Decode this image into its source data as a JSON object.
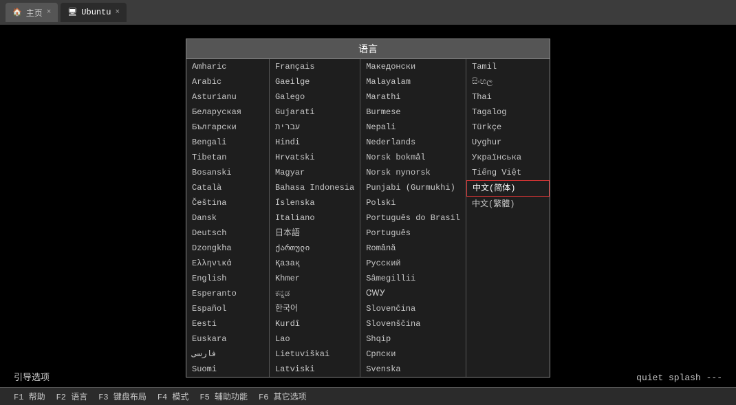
{
  "browser": {
    "tabs": [
      {
        "id": "home",
        "label": "主页",
        "icon": "🏠",
        "active": false,
        "closeable": true
      },
      {
        "id": "ubuntu",
        "label": "Ubuntu",
        "icon": "🖥",
        "active": true,
        "closeable": true
      }
    ]
  },
  "dialog": {
    "title": "语言",
    "columns": [
      {
        "items": [
          "Amharic",
          "Arabic",
          "Asturianu",
          "Беларуская",
          "Български",
          "Bengali",
          "Tibetan",
          "Bosanski",
          "Català",
          "Čeština",
          "Dansk",
          "Deutsch",
          "Dzongkha",
          "Ελληνικά",
          "English",
          "Esperanto",
          "Español",
          "Eesti",
          "Euskara",
          "فارسی",
          "Suomi"
        ]
      },
      {
        "items": [
          "Français",
          "Gaeilge",
          "Galego",
          "Gujarati",
          "עברית",
          "Hindi",
          "Hrvatski",
          "Magyar",
          "Bahasa Indonesia",
          "Íslenska",
          "Italiano",
          "日本語",
          "ქართული",
          "Қазақ",
          "Khmer",
          "ಕನ್ನಡ",
          "한국어",
          "Kurdî",
          "Lao",
          "Lietuviškai",
          "Latviski"
        ]
      },
      {
        "items": [
          "Македонски",
          "Malayalam",
          "Marathi",
          "Burmese",
          "Nepali",
          "Nederlands",
          "Norsk bokmål",
          "Norsk nynorsk",
          "Punjabi (Gurmukhi)",
          "Polski",
          "Português do Brasil",
          "Português",
          "Română",
          "Русский",
          "Sâmegillii",
          "ᏣᎳᎩ",
          "Slovenčina",
          "Slovenščina",
          "Shqip",
          "Српски",
          "Svenska"
        ]
      },
      {
        "items": [
          "Tamil",
          "සිංහල",
          "Thai",
          "Tagalog",
          "Türkçe",
          "Uyghur",
          "Українська",
          "Tiếng Việt",
          "中文(简体)",
          "中文(繁體)",
          "",
          "",
          "",
          "",
          "",
          "",
          "",
          "",
          "",
          "",
          ""
        ]
      }
    ],
    "selected": "中文(简体)"
  },
  "boot": {
    "options_label": "引导选项",
    "cmd_text": "quiet splash ---"
  },
  "footer": {
    "items": [
      "F1 帮助",
      "F2 语言",
      "F3 键盘布局",
      "F4 模式",
      "F5 辅助功能",
      "F6 其它选项"
    ]
  }
}
